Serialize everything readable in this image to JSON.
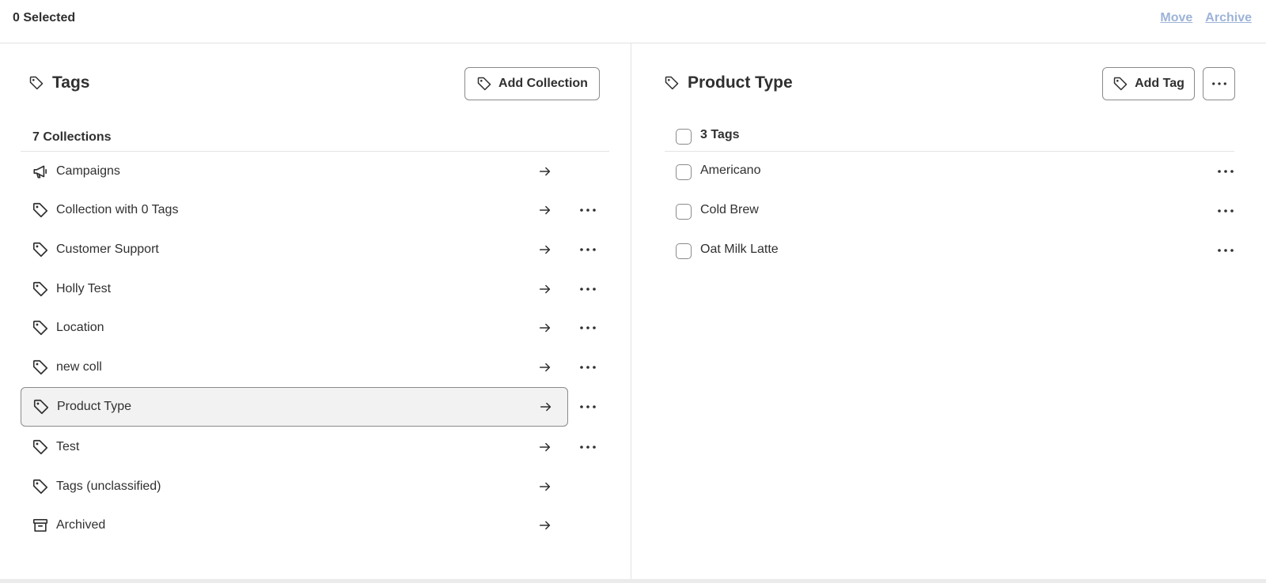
{
  "topbar": {
    "selected": "0 Selected",
    "move": "Move",
    "archive": "Archive"
  },
  "left": {
    "title": "Tags",
    "add_button": "Add Collection",
    "count": "7 Collections",
    "rows": [
      {
        "label": "Campaigns",
        "icon": "megaphone-icon"
      },
      {
        "label": "Collection with 0 Tags",
        "icon": "tag-icon"
      },
      {
        "label": "Customer Support",
        "icon": "tag-icon"
      },
      {
        "label": "Holly Test",
        "icon": "tag-icon"
      },
      {
        "label": "Location",
        "icon": "tag-icon"
      },
      {
        "label": "new coll",
        "icon": "tag-icon"
      },
      {
        "label": "Product Type",
        "icon": "tag-icon"
      },
      {
        "label": "Test",
        "icon": "tag-icon"
      },
      {
        "label": "Tags (unclassified)",
        "icon": "tag-icon"
      },
      {
        "label": "Archived",
        "icon": "archive-icon"
      }
    ]
  },
  "right": {
    "title": "Product Type",
    "add_button": "Add Tag",
    "count": "3 Tags",
    "tags": [
      {
        "label": "Americano"
      },
      {
        "label": "Cold Brew"
      },
      {
        "label": "Oat Milk Latte"
      }
    ]
  },
  "colors": {
    "link_disabled": "#9db3d8",
    "active_row_bg": "#f1f2f1",
    "text": "#303030",
    "border": "#8a8a8a"
  }
}
